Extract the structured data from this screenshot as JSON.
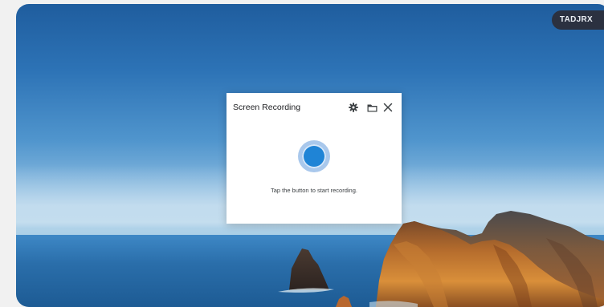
{
  "desktop": {
    "chip_label": "TADJRX"
  },
  "dialog": {
    "title": "Screen Recording",
    "icons": [
      "gear-icon",
      "folder-icon",
      "close-icon"
    ],
    "hint": "Tap the button to start recording.",
    "record_color": "#1f84d6"
  }
}
